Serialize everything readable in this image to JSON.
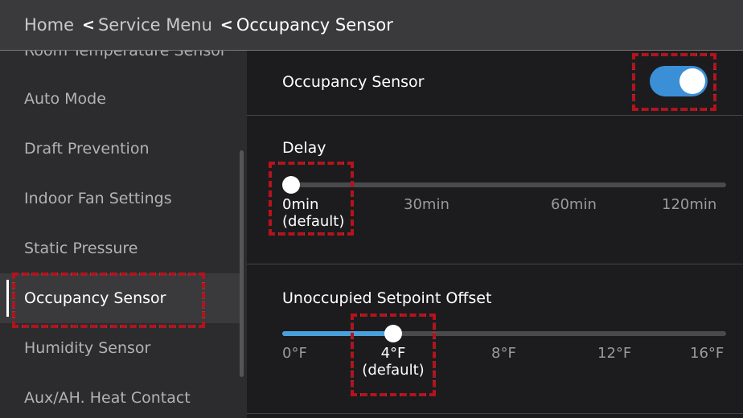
{
  "breadcrumb": {
    "home": "Home",
    "service_menu": "Service Menu",
    "current": "Occupancy Sensor",
    "separator": "<"
  },
  "sidebar": {
    "items": [
      {
        "label": "Room Temperature Sensor"
      },
      {
        "label": "Auto Mode"
      },
      {
        "label": "Draft Prevention"
      },
      {
        "label": "Indoor Fan Settings"
      },
      {
        "label": "Static Pressure"
      },
      {
        "label": "Occupancy Sensor",
        "active": true
      },
      {
        "label": "Humidity Sensor"
      },
      {
        "label": "Aux/AH. Heat Contact"
      }
    ]
  },
  "occupancy": {
    "label": "Occupancy Sensor",
    "enabled": true,
    "toggle_color": "#3b8fd6"
  },
  "delay": {
    "label": "Delay",
    "ticks": [
      "0min",
      "30min",
      "60min",
      "120min"
    ],
    "selected_line1": "0min",
    "selected_line2": "(default)",
    "value_fraction": 0
  },
  "offset": {
    "label": "Unoccupied Setpoint Offset",
    "ticks": [
      "0°F",
      "4°F",
      "8°F",
      "12°F",
      "16°F"
    ],
    "selected_line1": "4°F",
    "selected_line2": "(default)",
    "value_fraction": 0.25,
    "fill_color": "#4aa0dc"
  },
  "highlight_color": "#b5121b"
}
